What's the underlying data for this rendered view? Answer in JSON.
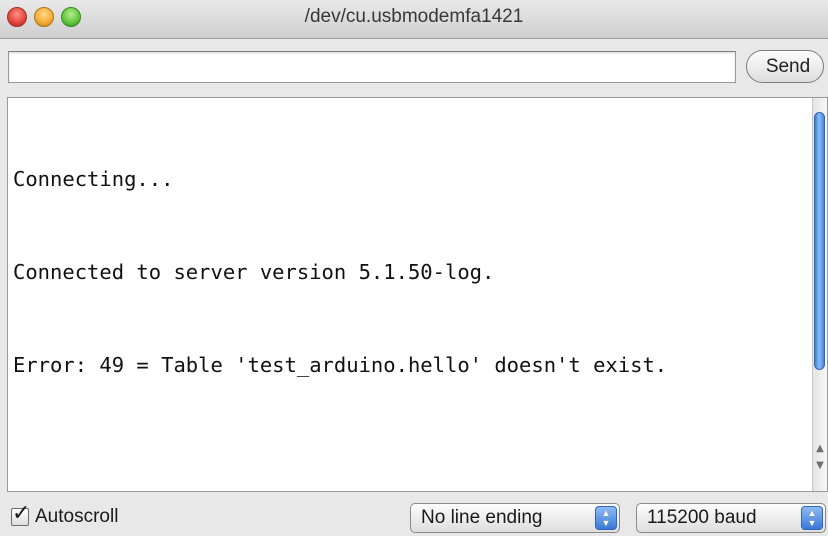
{
  "window": {
    "title": "/dev/cu.usbmodemfa1421"
  },
  "send": {
    "input_value": "",
    "button_label": "Send"
  },
  "output": {
    "lines": [
      "Connecting...",
      "Connected to server version 5.1.50-log.",
      "Error: 49 = Table 'test_arduino.hello' doesn't exist."
    ]
  },
  "bottom": {
    "autoscroll_label": "Autoscroll",
    "autoscroll_checked": true,
    "line_ending": "No line ending",
    "baud_rate": "115200 baud"
  },
  "icons": {
    "close": "close-button-icon",
    "minimize": "minimize-button-icon",
    "zoom": "zoom-button-icon",
    "checkbox": "checkmark-icon",
    "select": "select-arrows-icon",
    "scroll_up": "scroll-up-arrow-icon",
    "scroll_down": "scroll-down-arrow-icon"
  },
  "colors": {
    "accent": "#3a78d8",
    "close": "#e0443b",
    "minimize": "#f3a932",
    "zoom": "#5fc33a"
  }
}
